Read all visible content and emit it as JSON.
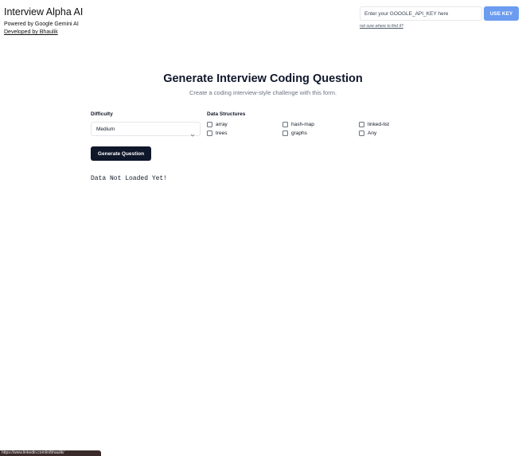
{
  "header": {
    "title": "Interview Alpha AI",
    "powered_by": "Powered by Google Gemini AI",
    "developed_by": "Developed by Bhaulik"
  },
  "api": {
    "placeholder": "Enter your GOOGLE_API_KEY here",
    "button_label": "USE KEY",
    "help_link": "not sure where to find it?"
  },
  "main": {
    "title": "Generate Interview Coding Question",
    "subtitle": "Create a coding interview-style challenge with this form.",
    "difficulty_label": "Difficulty",
    "difficulty_value": "Medium",
    "data_structures_label": "Data Structures",
    "data_structures": [
      {
        "label": "array",
        "checked": false
      },
      {
        "label": "hash-map",
        "checked": false
      },
      {
        "label": "linked-list",
        "checked": false
      },
      {
        "label": "trees",
        "checked": false
      },
      {
        "label": "graphs",
        "checked": false
      },
      {
        "label": "Any",
        "checked": false
      }
    ],
    "generate_label": "Generate Question",
    "status_text": "Data Not Loaded Yet!"
  },
  "status_bar": {
    "url": "https://www.linkedin.com/in/bhaulik/"
  },
  "icons": {
    "select_chevron": "chevron-down-icon"
  },
  "colors": {
    "primary_button": "#0f172a",
    "api_button": "#6b9cf0"
  }
}
